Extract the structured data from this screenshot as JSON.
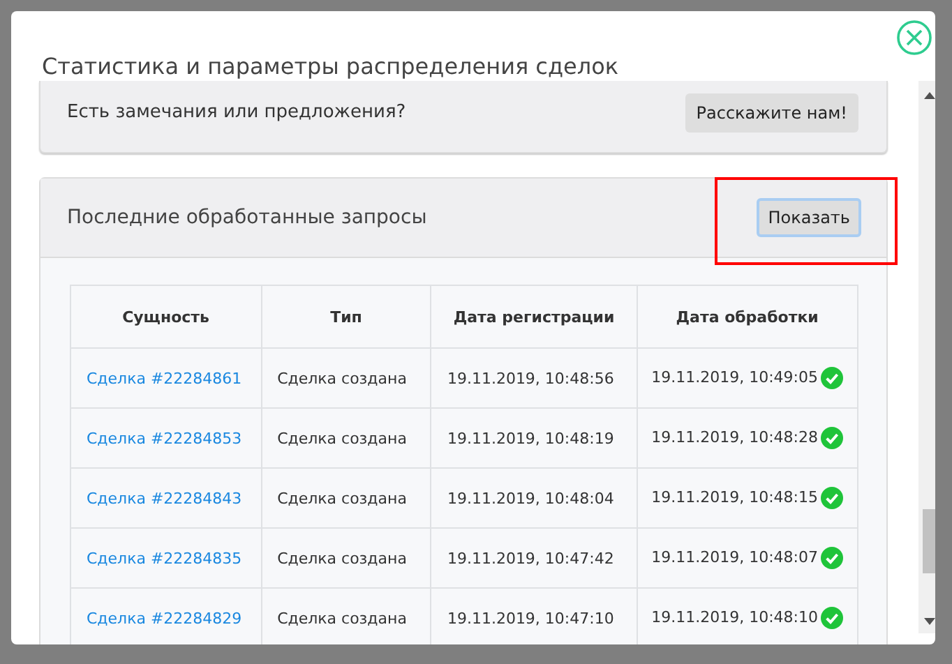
{
  "dialog": {
    "title": "Статистика и параметры распределения сделок"
  },
  "feedback_panel": {
    "text": "Есть замечания или предложения?",
    "button": "Расскажите нам!"
  },
  "requests_panel": {
    "title": "Последние обработанные запросы",
    "button": {
      "label": "Показать",
      "focused": true,
      "highlighted": true
    },
    "table": {
      "columns": [
        "Сущность",
        "Тип",
        "Дата регистрации",
        "Дата обработки"
      ],
      "rows": [
        {
          "entity": "Сделка #22284861",
          "type": "Сделка создана",
          "registered": "19.11.2019, 10:48:56",
          "processed": "19.11.2019, 10:49:05",
          "done": true
        },
        {
          "entity": "Сделка #22284853",
          "type": "Сделка создана",
          "registered": "19.11.2019, 10:48:19",
          "processed": "19.11.2019, 10:48:28",
          "done": true
        },
        {
          "entity": "Сделка #22284843",
          "type": "Сделка создана",
          "registered": "19.11.2019, 10:48:04",
          "processed": "19.11.2019, 10:48:15",
          "done": true
        },
        {
          "entity": "Сделка #22284835",
          "type": "Сделка создана",
          "registered": "19.11.2019, 10:47:42",
          "processed": "19.11.2019, 10:48:07",
          "done": true
        },
        {
          "entity": "Сделка #22284829",
          "type": "Сделка создана",
          "registered": "19.11.2019, 10:47:10",
          "processed": "19.11.2019, 10:48:10",
          "done": true
        }
      ]
    }
  }
}
